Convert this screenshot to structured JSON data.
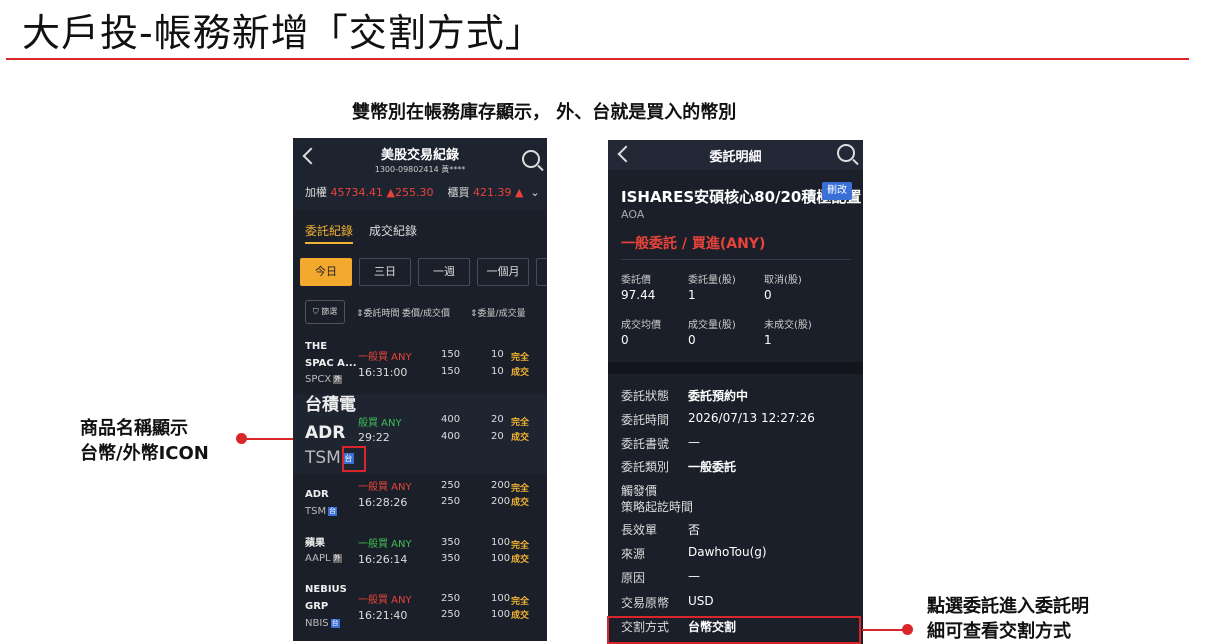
{
  "slide": {
    "title": "大戶投-帳務新增「交割方式」",
    "subtitle": "雙幣別在帳務庫存顯示， 外、台就是買入的幣別",
    "annotation_left": [
      "商品名稱顯示",
      "台幣/外幣ICON"
    ],
    "annotation_right": [
      "點選委託進入委託明",
      "細可查看交割方式"
    ]
  },
  "phone1": {
    "title": "美股交易紀錄",
    "account": "1300-09802414 黃****",
    "ticker1_label": "加權",
    "ticker1_value": "45734.41",
    "ticker1_change": "▲255.30",
    "ticker2_label": "櫃買",
    "ticker2_value": "421.39",
    "ticker2_change": "▲",
    "tabs": [
      "委託紀錄",
      "成交紀錄"
    ],
    "periods": [
      "今日",
      "三日",
      "一週",
      "一個月"
    ],
    "filter_label": "篩選",
    "sort1": "委託時間",
    "sort2": "委價/成交價",
    "sort3": "委量/成交量",
    "rows": [
      {
        "name1": "THE",
        "name2": "SPAC A...",
        "symbol": "SPCX",
        "badge": "外",
        "type": "一般買 ANY",
        "time": "16:31:00",
        "price1": "150",
        "price2": "150",
        "qty1": "10",
        "qty2": "10",
        "status1": "完全",
        "status2": "成交"
      },
      {
        "name1": "台積電",
        "name2": "ADR",
        "symbol": "TSM",
        "badge": "台",
        "type": "般買 ANY",
        "time": "29:22",
        "price1": "400",
        "price2": "400",
        "qty1": "20",
        "qty2": "20",
        "status1": "完全",
        "status2": "成交"
      },
      {
        "name1": "ADR",
        "name2": "",
        "symbol": "TSM",
        "badge": "台",
        "type": "一般買 ANY",
        "time": "16:28:26",
        "price1": "250",
        "price2": "250",
        "qty1": "200",
        "qty2": "200",
        "status1": "完全",
        "status2": "成交"
      },
      {
        "name1": "蘋果",
        "name2": "",
        "symbol": "AAPL",
        "badge": "外",
        "type": "一般買 ANY",
        "time": "16:26:14",
        "price1": "350",
        "price2": "350",
        "qty1": "100",
        "qty2": "100",
        "status1": "完全",
        "status2": "成交"
      },
      {
        "name1": "NEBIUS",
        "name2": "GRP",
        "symbol": "NBIS",
        "badge": "台",
        "type": "一般買 ANY",
        "time": "16:21:40",
        "price1": "250",
        "price2": "250",
        "qty1": "100",
        "qty2": "100",
        "status1": "完全",
        "status2": "成交"
      }
    ]
  },
  "phone2": {
    "title": "委託明細",
    "product": "ISHARES安碩核心80/20積極配置",
    "edit_label": "刪改",
    "code": "AOA",
    "order_type": "一般委託 / 買進(ANY)",
    "stats": [
      {
        "label": "委託價",
        "value": "97.44"
      },
      {
        "label": "委託量(股)",
        "value": "1"
      },
      {
        "label": "取消(股)",
        "value": "0"
      },
      {
        "label": "成交均價",
        "value": "0"
      },
      {
        "label": "成交量(股)",
        "value": "0"
      },
      {
        "label": "未成交(股)",
        "value": "1"
      }
    ],
    "details": [
      {
        "label": "委託狀態",
        "value": "委託預約中"
      },
      {
        "label": "委託時間",
        "value": "2026/07/13 12:27:26"
      },
      {
        "label": "委託書號",
        "value": "—"
      },
      {
        "label": "委託類別",
        "value": "一般委託"
      },
      {
        "label": "觸發價",
        "value": ""
      },
      {
        "label": "策略起訖時間",
        "value": ""
      },
      {
        "label": "長效單",
        "value": "否"
      },
      {
        "label": "來源",
        "value": "DawhoTou(g)"
      },
      {
        "label": "原因",
        "value": "—"
      },
      {
        "label": "交易原幣",
        "value": "USD"
      },
      {
        "label": "交割方式",
        "value": "台幣交割"
      }
    ]
  },
  "colors": {
    "accent_red": "#d9262b",
    "gold": "#f0b232",
    "dark_bg": "#1b1f29"
  }
}
